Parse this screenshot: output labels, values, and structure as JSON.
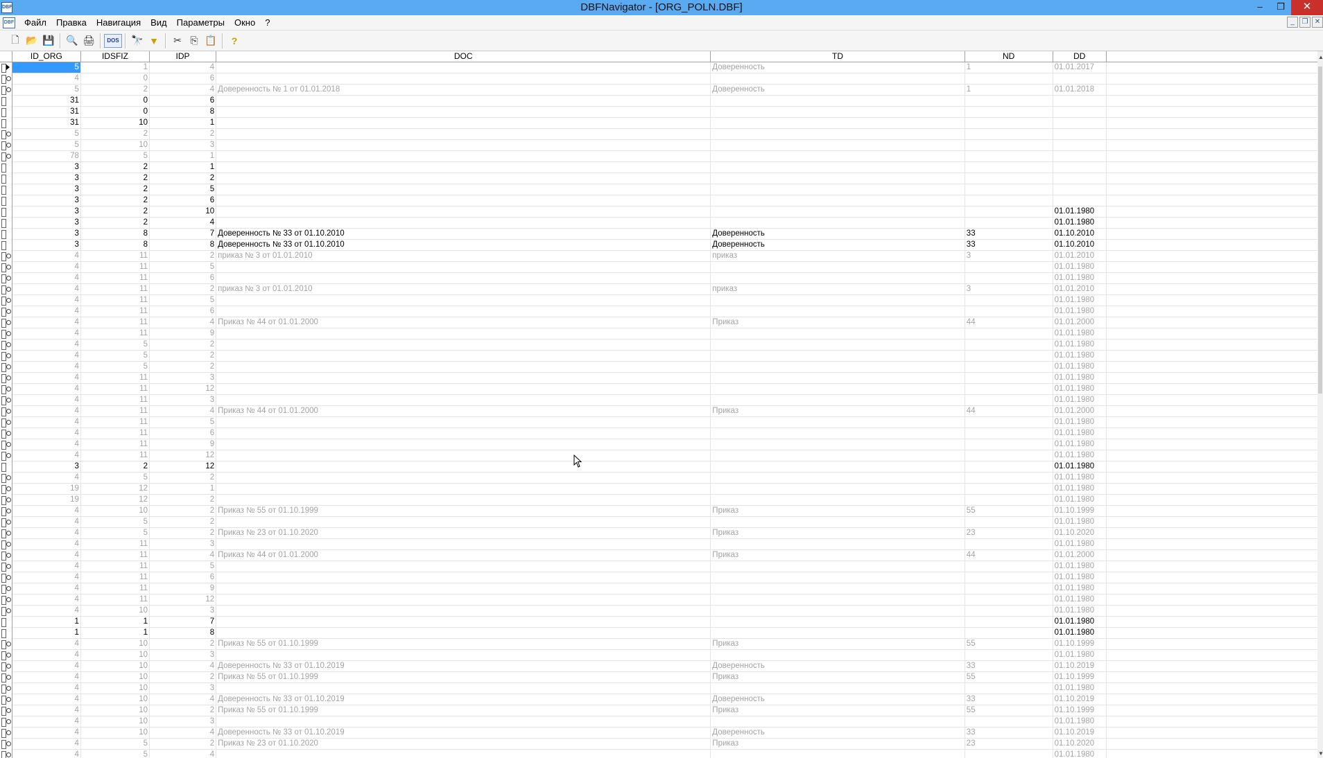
{
  "window": {
    "title": "DBFNavigator - [ORG_POLN.DBF]",
    "app_icon": "DBF",
    "minimize": "–",
    "restore": "❐",
    "close": "✕"
  },
  "menu": {
    "doc_icon": "DBF",
    "items": [
      "Файл",
      "Правка",
      "Навигация",
      "Вид",
      "Параметры",
      "Окно",
      "?"
    ]
  },
  "mdi": {
    "minimize": "_",
    "restore": "❐",
    "close": "✕"
  },
  "toolbar": {
    "new": "🗋",
    "open": "📂",
    "save": "💾",
    "preview": "🔍",
    "print": "🖨",
    "dos": "DOS",
    "find": "🔭",
    "filter": "▼",
    "cut": "✂",
    "copy": "⎘",
    "paste": "📋",
    "help": "?"
  },
  "columns": [
    "ID_ORG",
    "IDSFIZ",
    "IDP",
    "DOC",
    "TD",
    "ND",
    "DD",
    ""
  ],
  "rows": [
    {
      "s": "cur-dim",
      "v": [
        "5",
        "1",
        "4",
        "",
        "Доверенность",
        "1",
        "01.01.2017"
      ]
    },
    {
      "s": "dim",
      "v": [
        "4",
        "0",
        "6",
        "",
        "",
        "",
        ""
      ]
    },
    {
      "s": "dim",
      "v": [
        "5",
        "2",
        "4",
        "Доверенность № 1 от 01.01.2018",
        "Доверенность",
        "1",
        "01.01.2018"
      ]
    },
    {
      "s": "bold",
      "v": [
        "31",
        "0",
        "6",
        "",
        "",
        "",
        ""
      ]
    },
    {
      "s": "bold",
      "v": [
        "31",
        "0",
        "8",
        "",
        "",
        "",
        ""
      ]
    },
    {
      "s": "bold",
      "v": [
        "31",
        "10",
        "1",
        "",
        "",
        "",
        ""
      ]
    },
    {
      "s": "dim",
      "v": [
        "5",
        "2",
        "2",
        "",
        "",
        "",
        ""
      ]
    },
    {
      "s": "dim",
      "v": [
        "5",
        "10",
        "3",
        "",
        "",
        "",
        ""
      ]
    },
    {
      "s": "dim",
      "v": [
        "78",
        "5",
        "1",
        "",
        "",
        "",
        ""
      ]
    },
    {
      "s": "bold",
      "v": [
        "3",
        "2",
        "1",
        "",
        "",
        "",
        ""
      ]
    },
    {
      "s": "bold",
      "v": [
        "3",
        "2",
        "2",
        "",
        "",
        "",
        ""
      ]
    },
    {
      "s": "bold",
      "v": [
        "3",
        "2",
        "5",
        "",
        "",
        "",
        ""
      ]
    },
    {
      "s": "bold",
      "v": [
        "3",
        "2",
        "6",
        "",
        "",
        "",
        ""
      ]
    },
    {
      "s": "bold",
      "v": [
        "3",
        "2",
        "10",
        "",
        "",
        "",
        "01.01.1980"
      ]
    },
    {
      "s": "bold",
      "v": [
        "3",
        "2",
        "4",
        "",
        "",
        "",
        "01.01.1980"
      ]
    },
    {
      "s": "bold",
      "v": [
        "3",
        "8",
        "7",
        "Доверенность № 33 от 01.10.2010",
        "Доверенность",
        "33",
        "01.10.2010"
      ]
    },
    {
      "s": "bold",
      "v": [
        "3",
        "8",
        "8",
        "Доверенность № 33 от 01.10.2010",
        "Доверенность",
        "33",
        "01.10.2010"
      ]
    },
    {
      "s": "dim",
      "v": [
        "4",
        "11",
        "2",
        "приказ № 3 от 01.01.2010",
        "приказ",
        "3",
        "01.01.2010"
      ]
    },
    {
      "s": "dim",
      "v": [
        "4",
        "11",
        "5",
        "",
        "",
        "",
        "01.01.1980"
      ]
    },
    {
      "s": "dim",
      "v": [
        "4",
        "11",
        "6",
        "",
        "",
        "",
        "01.01.1980"
      ]
    },
    {
      "s": "dim",
      "v": [
        "4",
        "11",
        "2",
        "приказ № 3 от 01.01.2010",
        "приказ",
        "3",
        "01.01.2010"
      ]
    },
    {
      "s": "dim",
      "v": [
        "4",
        "11",
        "5",
        "",
        "",
        "",
        "01.01.1980"
      ]
    },
    {
      "s": "dim",
      "v": [
        "4",
        "11",
        "6",
        "",
        "",
        "",
        "01.01.1980"
      ]
    },
    {
      "s": "dim",
      "v": [
        "4",
        "11",
        "4",
        "Приказ № 44 от 01.01.2000",
        "Приказ",
        "44",
        "01.01.2000"
      ]
    },
    {
      "s": "dim",
      "v": [
        "4",
        "11",
        "9",
        "",
        "",
        "",
        "01.01.1980"
      ]
    },
    {
      "s": "dim",
      "v": [
        "4",
        "5",
        "2",
        "",
        "",
        "",
        "01.01.1980"
      ]
    },
    {
      "s": "dim",
      "v": [
        "4",
        "5",
        "2",
        "",
        "",
        "",
        "01.01.1980"
      ]
    },
    {
      "s": "dim",
      "v": [
        "4",
        "5",
        "2",
        "",
        "",
        "",
        "01.01.1980"
      ]
    },
    {
      "s": "dim",
      "v": [
        "4",
        "11",
        "3",
        "",
        "",
        "",
        "01.01.1980"
      ]
    },
    {
      "s": "dim",
      "v": [
        "4",
        "11",
        "12",
        "",
        "",
        "",
        "01.01.1980"
      ]
    },
    {
      "s": "dim",
      "v": [
        "4",
        "11",
        "3",
        "",
        "",
        "",
        "01.01.1980"
      ]
    },
    {
      "s": "dim",
      "v": [
        "4",
        "11",
        "4",
        "Приказ № 44 от 01.01.2000",
        "Приказ",
        "44",
        "01.01.2000"
      ]
    },
    {
      "s": "dim",
      "v": [
        "4",
        "11",
        "5",
        "",
        "",
        "",
        "01.01.1980"
      ]
    },
    {
      "s": "dim",
      "v": [
        "4",
        "11",
        "6",
        "",
        "",
        "",
        "01.01.1980"
      ]
    },
    {
      "s": "dim",
      "v": [
        "4",
        "11",
        "9",
        "",
        "",
        "",
        "01.01.1980"
      ]
    },
    {
      "s": "dim",
      "v": [
        "4",
        "11",
        "12",
        "",
        "",
        "",
        "01.01.1980"
      ]
    },
    {
      "s": "bold",
      "v": [
        "3",
        "2",
        "12",
        "",
        "",
        "",
        "01.01.1980"
      ]
    },
    {
      "s": "dim",
      "v": [
        "4",
        "5",
        "2",
        "",
        "",
        "",
        "01.01.1980"
      ]
    },
    {
      "s": "dim",
      "v": [
        "19",
        "12",
        "1",
        "",
        "",
        "",
        "01.01.1980"
      ]
    },
    {
      "s": "dim",
      "v": [
        "19",
        "12",
        "2",
        "",
        "",
        "",
        "01.01.1980"
      ]
    },
    {
      "s": "dim",
      "v": [
        "4",
        "10",
        "2",
        "Приказ № 55 от 01.10.1999",
        "Приказ",
        "55",
        "01.10.1999"
      ]
    },
    {
      "s": "dim",
      "v": [
        "4",
        "5",
        "2",
        "",
        "",
        "",
        "01.01.1980"
      ]
    },
    {
      "s": "dim",
      "v": [
        "4",
        "5",
        "2",
        "Приказ № 23 от 01.10.2020",
        "Приказ",
        "23",
        "01.10.2020"
      ]
    },
    {
      "s": "dim",
      "v": [
        "4",
        "11",
        "3",
        "",
        "",
        "",
        "01.01.1980"
      ]
    },
    {
      "s": "dim",
      "v": [
        "4",
        "11",
        "4",
        "Приказ № 44 от 01.01.2000",
        "Приказ",
        "44",
        "01.01.2000"
      ]
    },
    {
      "s": "dim",
      "v": [
        "4",
        "11",
        "5",
        "",
        "",
        "",
        "01.01.1980"
      ]
    },
    {
      "s": "dim",
      "v": [
        "4",
        "11",
        "6",
        "",
        "",
        "",
        "01.01.1980"
      ]
    },
    {
      "s": "dim",
      "v": [
        "4",
        "11",
        "9",
        "",
        "",
        "",
        "01.01.1980"
      ]
    },
    {
      "s": "dim",
      "v": [
        "4",
        "11",
        "12",
        "",
        "",
        "",
        "01.01.1980"
      ]
    },
    {
      "s": "dim",
      "v": [
        "4",
        "10",
        "3",
        "",
        "",
        "",
        "01.01.1980"
      ]
    },
    {
      "s": "bold",
      "v": [
        "1",
        "1",
        "7",
        "",
        "",
        "",
        "01.01.1980"
      ]
    },
    {
      "s": "bold",
      "v": [
        "1",
        "1",
        "8",
        "",
        "",
        "",
        "01.01.1980"
      ]
    },
    {
      "s": "dim",
      "v": [
        "4",
        "10",
        "2",
        "Приказ № 55 от 01.10.1999",
        "Приказ",
        "55",
        "01.10.1999"
      ]
    },
    {
      "s": "dim",
      "v": [
        "4",
        "10",
        "3",
        "",
        "",
        "",
        "01.01.1980"
      ]
    },
    {
      "s": "dim",
      "v": [
        "4",
        "10",
        "4",
        "Доверенность № 33 от 01.10.2019",
        "Доверенность",
        "33",
        "01.10.2019"
      ]
    },
    {
      "s": "dim",
      "v": [
        "4",
        "10",
        "2",
        "Приказ № 55 от 01.10.1999",
        "Приказ",
        "55",
        "01.10.1999"
      ]
    },
    {
      "s": "dim",
      "v": [
        "4",
        "10",
        "3",
        "",
        "",
        "",
        "01.01.1980"
      ]
    },
    {
      "s": "dim",
      "v": [
        "4",
        "10",
        "4",
        "Доверенность № 33 от 01.10.2019",
        "Доверенность",
        "33",
        "01.10.2019"
      ]
    },
    {
      "s": "dim",
      "v": [
        "4",
        "10",
        "2",
        "Приказ № 55 от 01.10.1999",
        "Приказ",
        "55",
        "01.10.1999"
      ]
    },
    {
      "s": "dim",
      "v": [
        "4",
        "10",
        "3",
        "",
        "",
        "",
        "01.01.1980"
      ]
    },
    {
      "s": "dim",
      "v": [
        "4",
        "10",
        "4",
        "Доверенность № 33 от 01.10.2019",
        "Доверенность",
        "33",
        "01.10.2019"
      ]
    },
    {
      "s": "dim",
      "v": [
        "4",
        "5",
        "2",
        "Приказ № 23 от 01.10.2020",
        "Приказ",
        "23",
        "01.10.2020"
      ]
    },
    {
      "s": "dim",
      "v": [
        "4",
        "5",
        "4",
        "",
        "",
        "",
        "01.01.1980"
      ]
    }
  ],
  "scrollbar": {
    "up": "▲",
    "down": "▼"
  }
}
